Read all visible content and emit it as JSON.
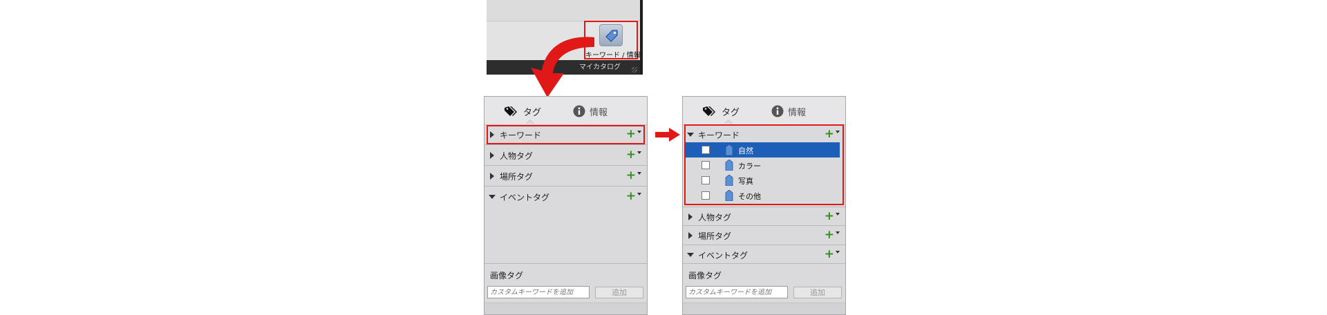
{
  "toolbar": {
    "keyword_button_label": "キーワード / 情報",
    "footer_label": "マイカタログ",
    "tag_icon": "price-tag-icon"
  },
  "panel": {
    "tabs": [
      {
        "label": "タグ",
        "icon": "tags-icon"
      },
      {
        "label": "情報",
        "icon": "info-icon"
      }
    ],
    "categories": [
      {
        "label": "キーワード"
      },
      {
        "label": "人物タグ"
      },
      {
        "label": "場所タグ"
      },
      {
        "label": "イベントタグ"
      }
    ],
    "add_symbol": "+",
    "bottom": {
      "title": "画像タグ",
      "input_placeholder": "カスタムキーワードを追加",
      "add_button_label": "追加"
    }
  },
  "keywords": [
    {
      "name": "自然",
      "selected": true
    },
    {
      "name": "カラー",
      "selected": false
    },
    {
      "name": "写真",
      "selected": false
    },
    {
      "name": "その他",
      "selected": false
    }
  ],
  "colors": {
    "highlight": "#e01818",
    "selection": "#1d5fb8",
    "add_green": "#3a8d22",
    "tag_blue": "#5b8fd6"
  }
}
